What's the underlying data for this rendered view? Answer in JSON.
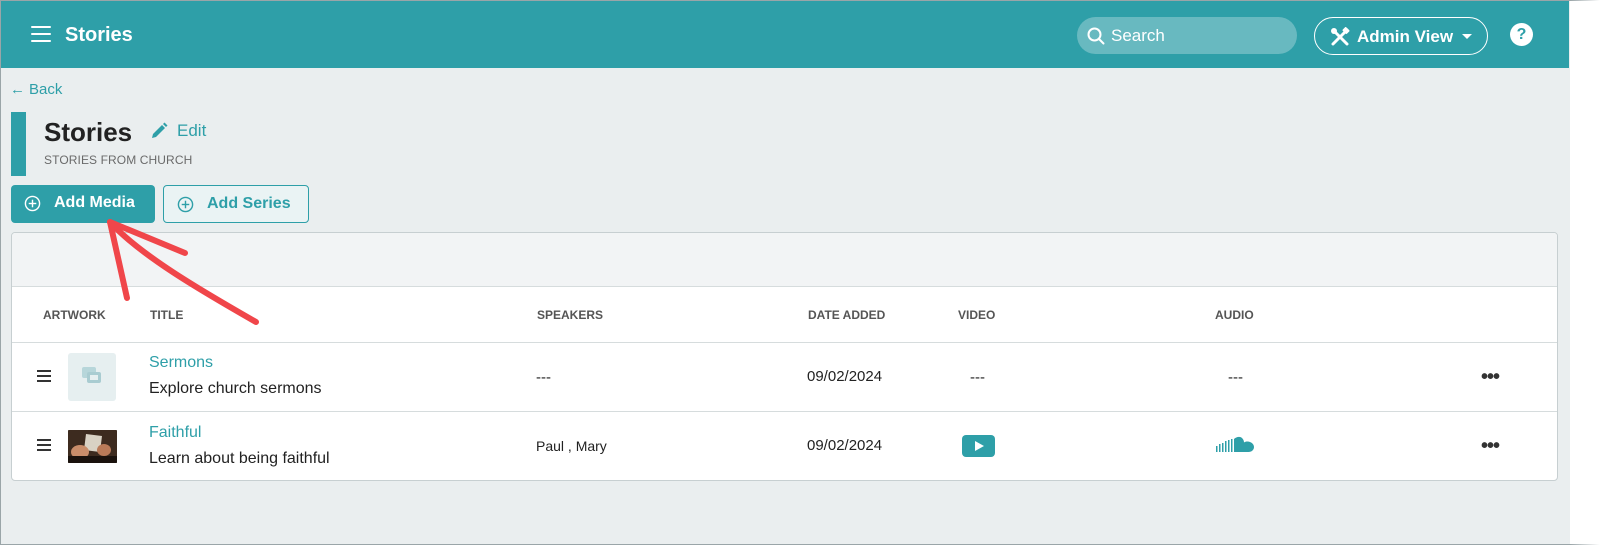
{
  "header": {
    "title": "Stories",
    "search_placeholder": "Search",
    "admin_view_label": "Admin View",
    "help_label": "?"
  },
  "nav": {
    "back_label": "Back"
  },
  "page": {
    "title": "Stories",
    "edit_label": "Edit",
    "subtitle": "STORIES FROM CHURCH"
  },
  "actions": {
    "add_media_label": "Add Media",
    "add_series_label": "Add Series"
  },
  "table": {
    "headers": {
      "artwork": "ARTWORK",
      "title": "TITLE",
      "speakers": "SPEAKERS",
      "date_added": "DATE ADDED",
      "video": "VIDEO",
      "audio": "AUDIO"
    },
    "rows": [
      {
        "title": "Sermons",
        "description": "Explore church sermons",
        "speakers": "---",
        "date_added": "09/02/2024",
        "video": "---",
        "audio": "---",
        "more": "•••"
      },
      {
        "title": "Faithful",
        "description": "Learn about being faithful",
        "speakers": "Paul , Mary",
        "date_added": "09/02/2024",
        "video_icon": "play-button-icon",
        "audio_icon": "soundcloud-icon",
        "more": "•••"
      }
    ]
  },
  "colors": {
    "accent": "#2e9fa8",
    "background": "#eaeeef",
    "annotation_arrow": "#f0464a"
  }
}
